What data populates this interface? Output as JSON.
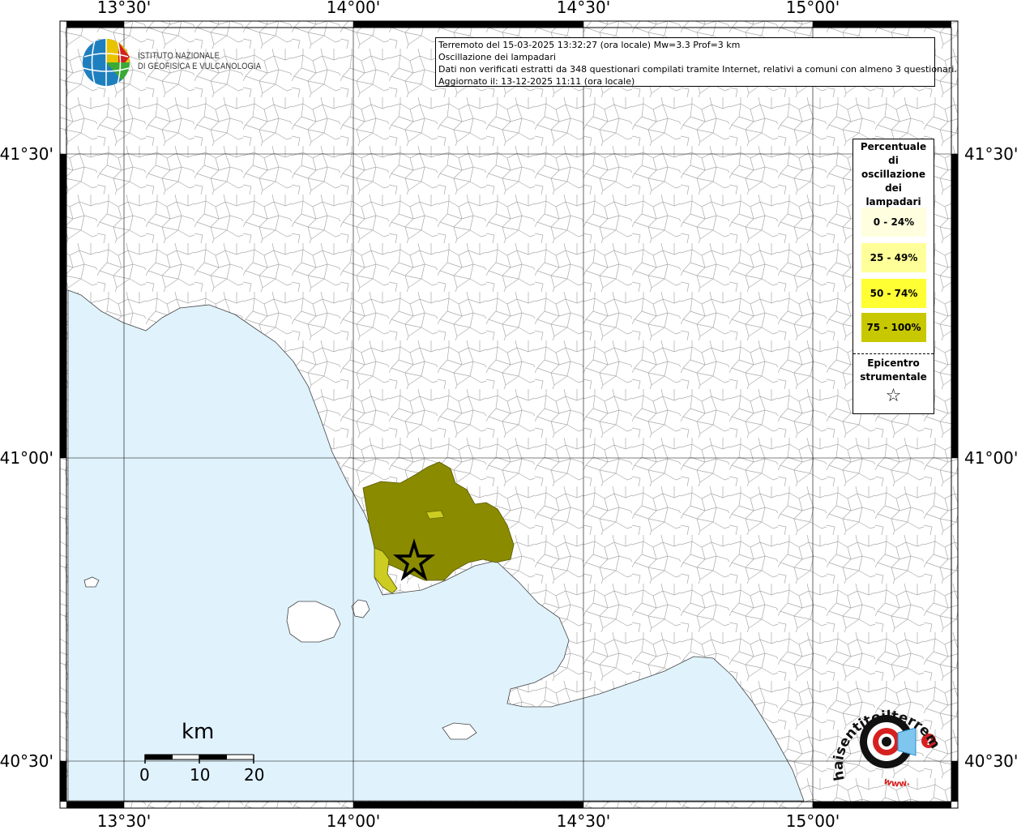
{
  "map": {
    "lon_labels": [
      "13°30'",
      "14°00'",
      "14°30'",
      "15°00'"
    ],
    "lat_labels": [
      "41°30'",
      "41°00'",
      "40°30'"
    ],
    "colors": {
      "sea": "#e0f2fc",
      "land": "#ffffff",
      "class_0_24": "#ffffe0",
      "class_25_49": "#ffff99",
      "class_50_74": "#ffff33",
      "class_75_100": "#c8c800",
      "affected_dark": "#8b8b00",
      "affected_light": "#cccc22"
    }
  },
  "logo": {
    "line1": "ISTITUTO NAZIONALE",
    "line2": "DI GEOFISICA E VULCANOLOGIA"
  },
  "info": {
    "line1": "Terremoto del 15-03-2025 13:32:27 (ora locale) Mw=3.3 Prof=3 km",
    "line2": "Oscillazione dei lampadari",
    "line3": "Dati non verificati estratti da 348 questionari compilati tramite Internet, relativi a comuni con almeno 3 questionari.",
    "line4": "Aggiornato il: 13-12-2025 11:11 (ora locale)"
  },
  "legend": {
    "title": [
      "Percentuale",
      "di",
      "oscillazione",
      "dei",
      "lampadari"
    ],
    "classes": [
      {
        "label": "0 - 24%",
        "color": "#ffffe0"
      },
      {
        "label": "25 - 49%",
        "color": "#ffff99"
      },
      {
        "label": "50 - 74%",
        "color": "#ffff33"
      },
      {
        "label": "75 - 100%",
        "color": "#c8c800"
      }
    ],
    "epicenter_label": [
      "Epicentro",
      "strumentale"
    ],
    "epicenter_symbol": "☆"
  },
  "scale_bar": {
    "unit": "km",
    "ticks": [
      "0",
      "10",
      "20"
    ]
  },
  "badge": {
    "text_top": "haisentitoilterremoto.it",
    "text_bottom": "www."
  }
}
